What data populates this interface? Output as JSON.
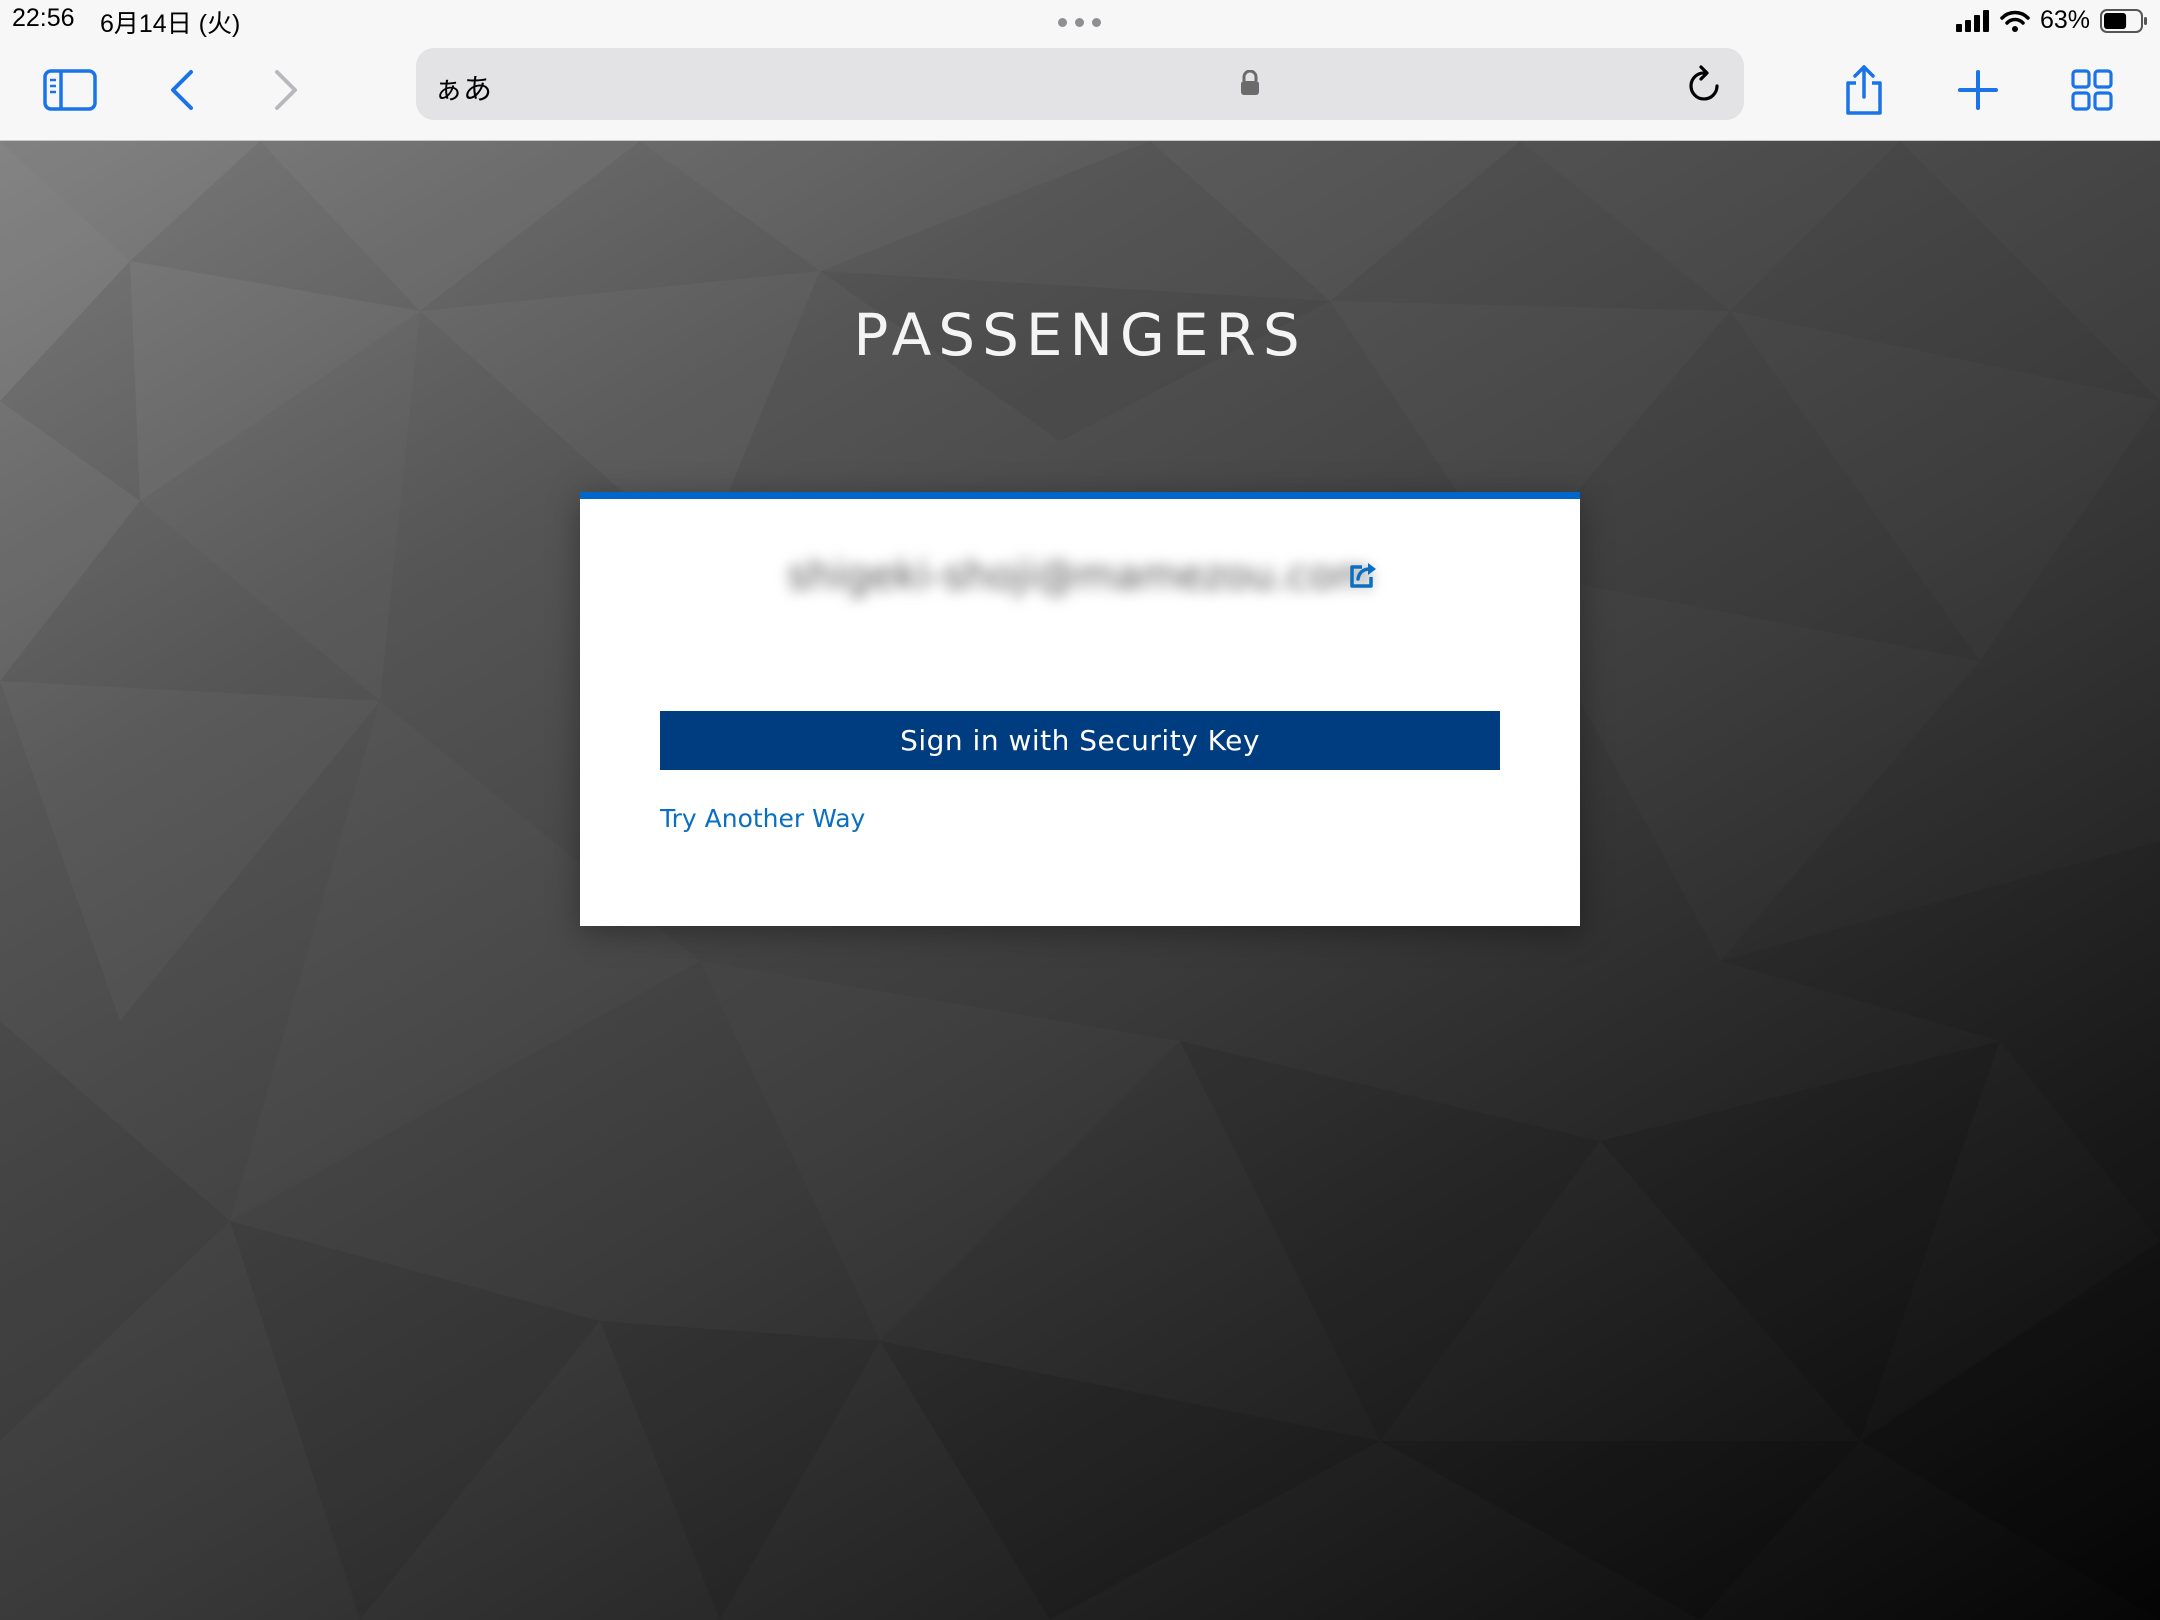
{
  "status_bar": {
    "time": "22:56",
    "date": "6月14日 (火)",
    "battery_percent": "63%",
    "battery_level": 0.63,
    "icons": [
      "more-dots-icon",
      "cellular-signal-icon",
      "wifi-icon",
      "battery-icon"
    ]
  },
  "toolbar": {
    "address_text": "ぁあ",
    "icons": [
      "sidebar-icon",
      "back-icon",
      "forward-icon",
      "lock-icon",
      "reload-icon",
      "share-icon",
      "new-tab-icon",
      "tabs-overview-icon"
    ],
    "accent_color": "#1a73e8"
  },
  "login": {
    "brand": "PASSENGERS",
    "username": "shigeki-shoji@mamezou.com",
    "signin_button": "Sign in with Security Key",
    "try_another_way": "Try Another Way",
    "button_color": "#003d80",
    "top_border_color": "#0066cc",
    "link_color": "#0a6fc2"
  }
}
